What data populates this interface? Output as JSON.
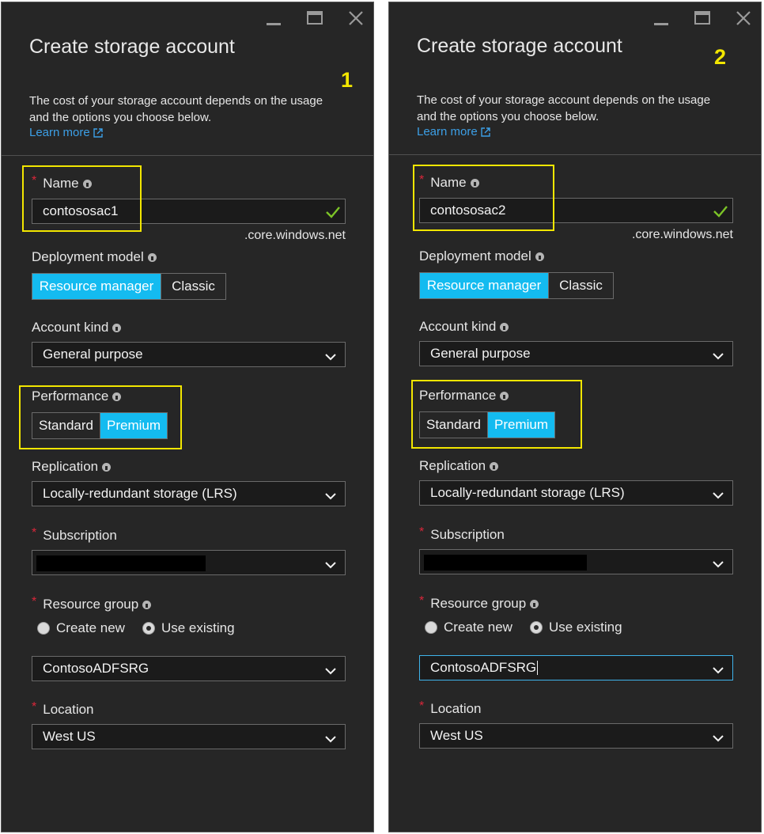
{
  "colors": {
    "panel_bg": "#262626",
    "accent_selected": "#14bbf0",
    "link": "#3c9fe6",
    "required_star": "#d9263a",
    "highlight": "#f2e600",
    "valid_check": "#7cc427"
  },
  "icons": {
    "minimize": "minimize-icon",
    "maximize": "maximize-icon",
    "close": "close-icon",
    "info": "info-icon",
    "external_link": "external-link-icon",
    "chevron": "chevron-down-icon",
    "check": "check-icon"
  },
  "panels": [
    {
      "title": "Create storage account",
      "step": "1",
      "description": "The cost of your storage account depends on the usage and the options you choose below.",
      "learn_more": "Learn more",
      "name_label": "Name",
      "name_value": "contososac1",
      "name_suffix": ".core.windows.net",
      "deployment_label": "Deployment model",
      "deployment_options": [
        "Resource manager",
        "Classic"
      ],
      "deployment_selected": "Resource manager",
      "account_kind_label": "Account kind",
      "account_kind_value": "General purpose",
      "performance_label": "Performance",
      "performance_options": [
        "Standard",
        "Premium"
      ],
      "performance_selected": "Premium",
      "replication_label": "Replication",
      "replication_value": "Locally-redundant storage (LRS)",
      "subscription_label": "Subscription",
      "resource_group_label": "Resource group",
      "resource_group_options": [
        "Create new",
        "Use existing"
      ],
      "resource_group_selected": "Use existing",
      "resource_group_value": "ContosoADFSRG",
      "location_label": "Location",
      "location_value": "West US"
    },
    {
      "title": "Create storage account",
      "step": "2",
      "description": "The cost of your storage account depends on the usage and the options you choose below.",
      "learn_more": "Learn more",
      "name_label": "Name",
      "name_value": "contososac2",
      "name_suffix": ".core.windows.net",
      "deployment_label": "Deployment model",
      "deployment_options": [
        "Resource manager",
        "Classic"
      ],
      "deployment_selected": "Resource manager",
      "account_kind_label": "Account kind",
      "account_kind_value": "General purpose",
      "performance_label": "Performance",
      "performance_options": [
        "Standard",
        "Premium"
      ],
      "performance_selected": "Premium",
      "replication_label": "Replication",
      "replication_value": "Locally-redundant storage (LRS)",
      "subscription_label": "Subscription",
      "resource_group_label": "Resource group",
      "resource_group_options": [
        "Create new",
        "Use existing"
      ],
      "resource_group_selected": "Use existing",
      "resource_group_value": "ContosoADFSRG",
      "location_label": "Location",
      "location_value": "West US"
    }
  ]
}
